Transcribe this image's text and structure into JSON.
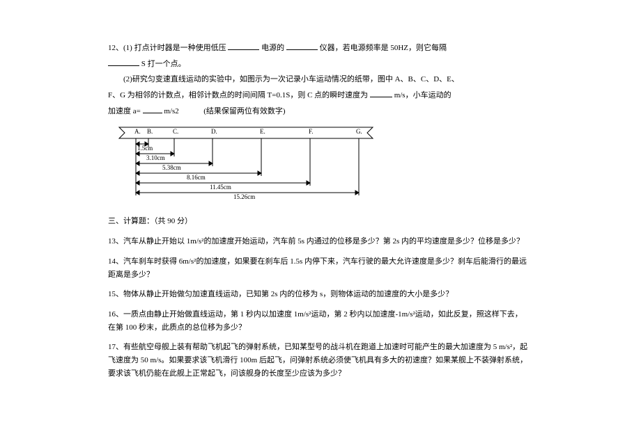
{
  "q12": {
    "line1_p1": "12、(1) 打点计时器是一种使用低压",
    "line1_p2": "电源的",
    "line1_p3": "仪器，若电源频率是 50HZ，则它每隔",
    "line2_p1": "S 打一个点。",
    "line3": "(2)研究匀变速直线运动的实验中，如图示为一次记录小车运动情况的纸带，图中 A、B、C、D、E、",
    "line4_p1": "F、G 为相邻的计数点，相邻计数点的时间间隔 T=0.1S，则 C 点的瞬时速度为",
    "line4_p2": "m/s，小车运动的",
    "line5_p1": "加速度 a=",
    "line5_p2": "m/s2",
    "line5_p3": "(结果保留两位有效数字)"
  },
  "diagram": {
    "labels": [
      "A.",
      "B.",
      "C.",
      "D.",
      "E.",
      "F.",
      "G."
    ],
    "measures": [
      "1.5cm",
      "3.10cm",
      "5.38cm",
      "8.16cm",
      "11.45cm",
      "15.26cm"
    ]
  },
  "sec3_title": "三、计算题：（共 90 分）",
  "q13": "13、汽车从静止开始以 1m/s²的加速度开始运动，汽车前 5s 内通过的位移是多少？第 2s 内的平均速度是多少？位移是多少？",
  "q14": "14、汽车刹车时获得 6m/s²的加速度，如果要在刹车后 1.5s 内停下来，汽车行驶的最大允许速度是多少？刹车后能滑行的最远距离是多少？",
  "q15": "15、物体从静止开始做匀加速直线运动，已知第 2s 内的位移为 s，则物体运动的加速度的大小是多少？",
  "q16": "16、一质点由静止开始做直线运动，第 1 秒内以加速度 1m/s²运动，第 2 秒内以加速度-1m/s²运动，如此反复，照这样下去，在第 100 秒末，此质点的总位移为多少？",
  "q17": "17、有些航空母舰上装有帮助飞机起飞的弹射系统，已知某型号的战斗机在跑道上加速时可能产生的最大加速度为 5 m/s²，起飞速度为 50 m/s。如果要求该飞机滑行 100m 后起飞，问弹射系统必须使飞机具有多大的初速度？如果某舰上不装弹射系统，要求该飞机仍能在此舰上正常起飞，问该舰身的长度至少应该为多少？"
}
